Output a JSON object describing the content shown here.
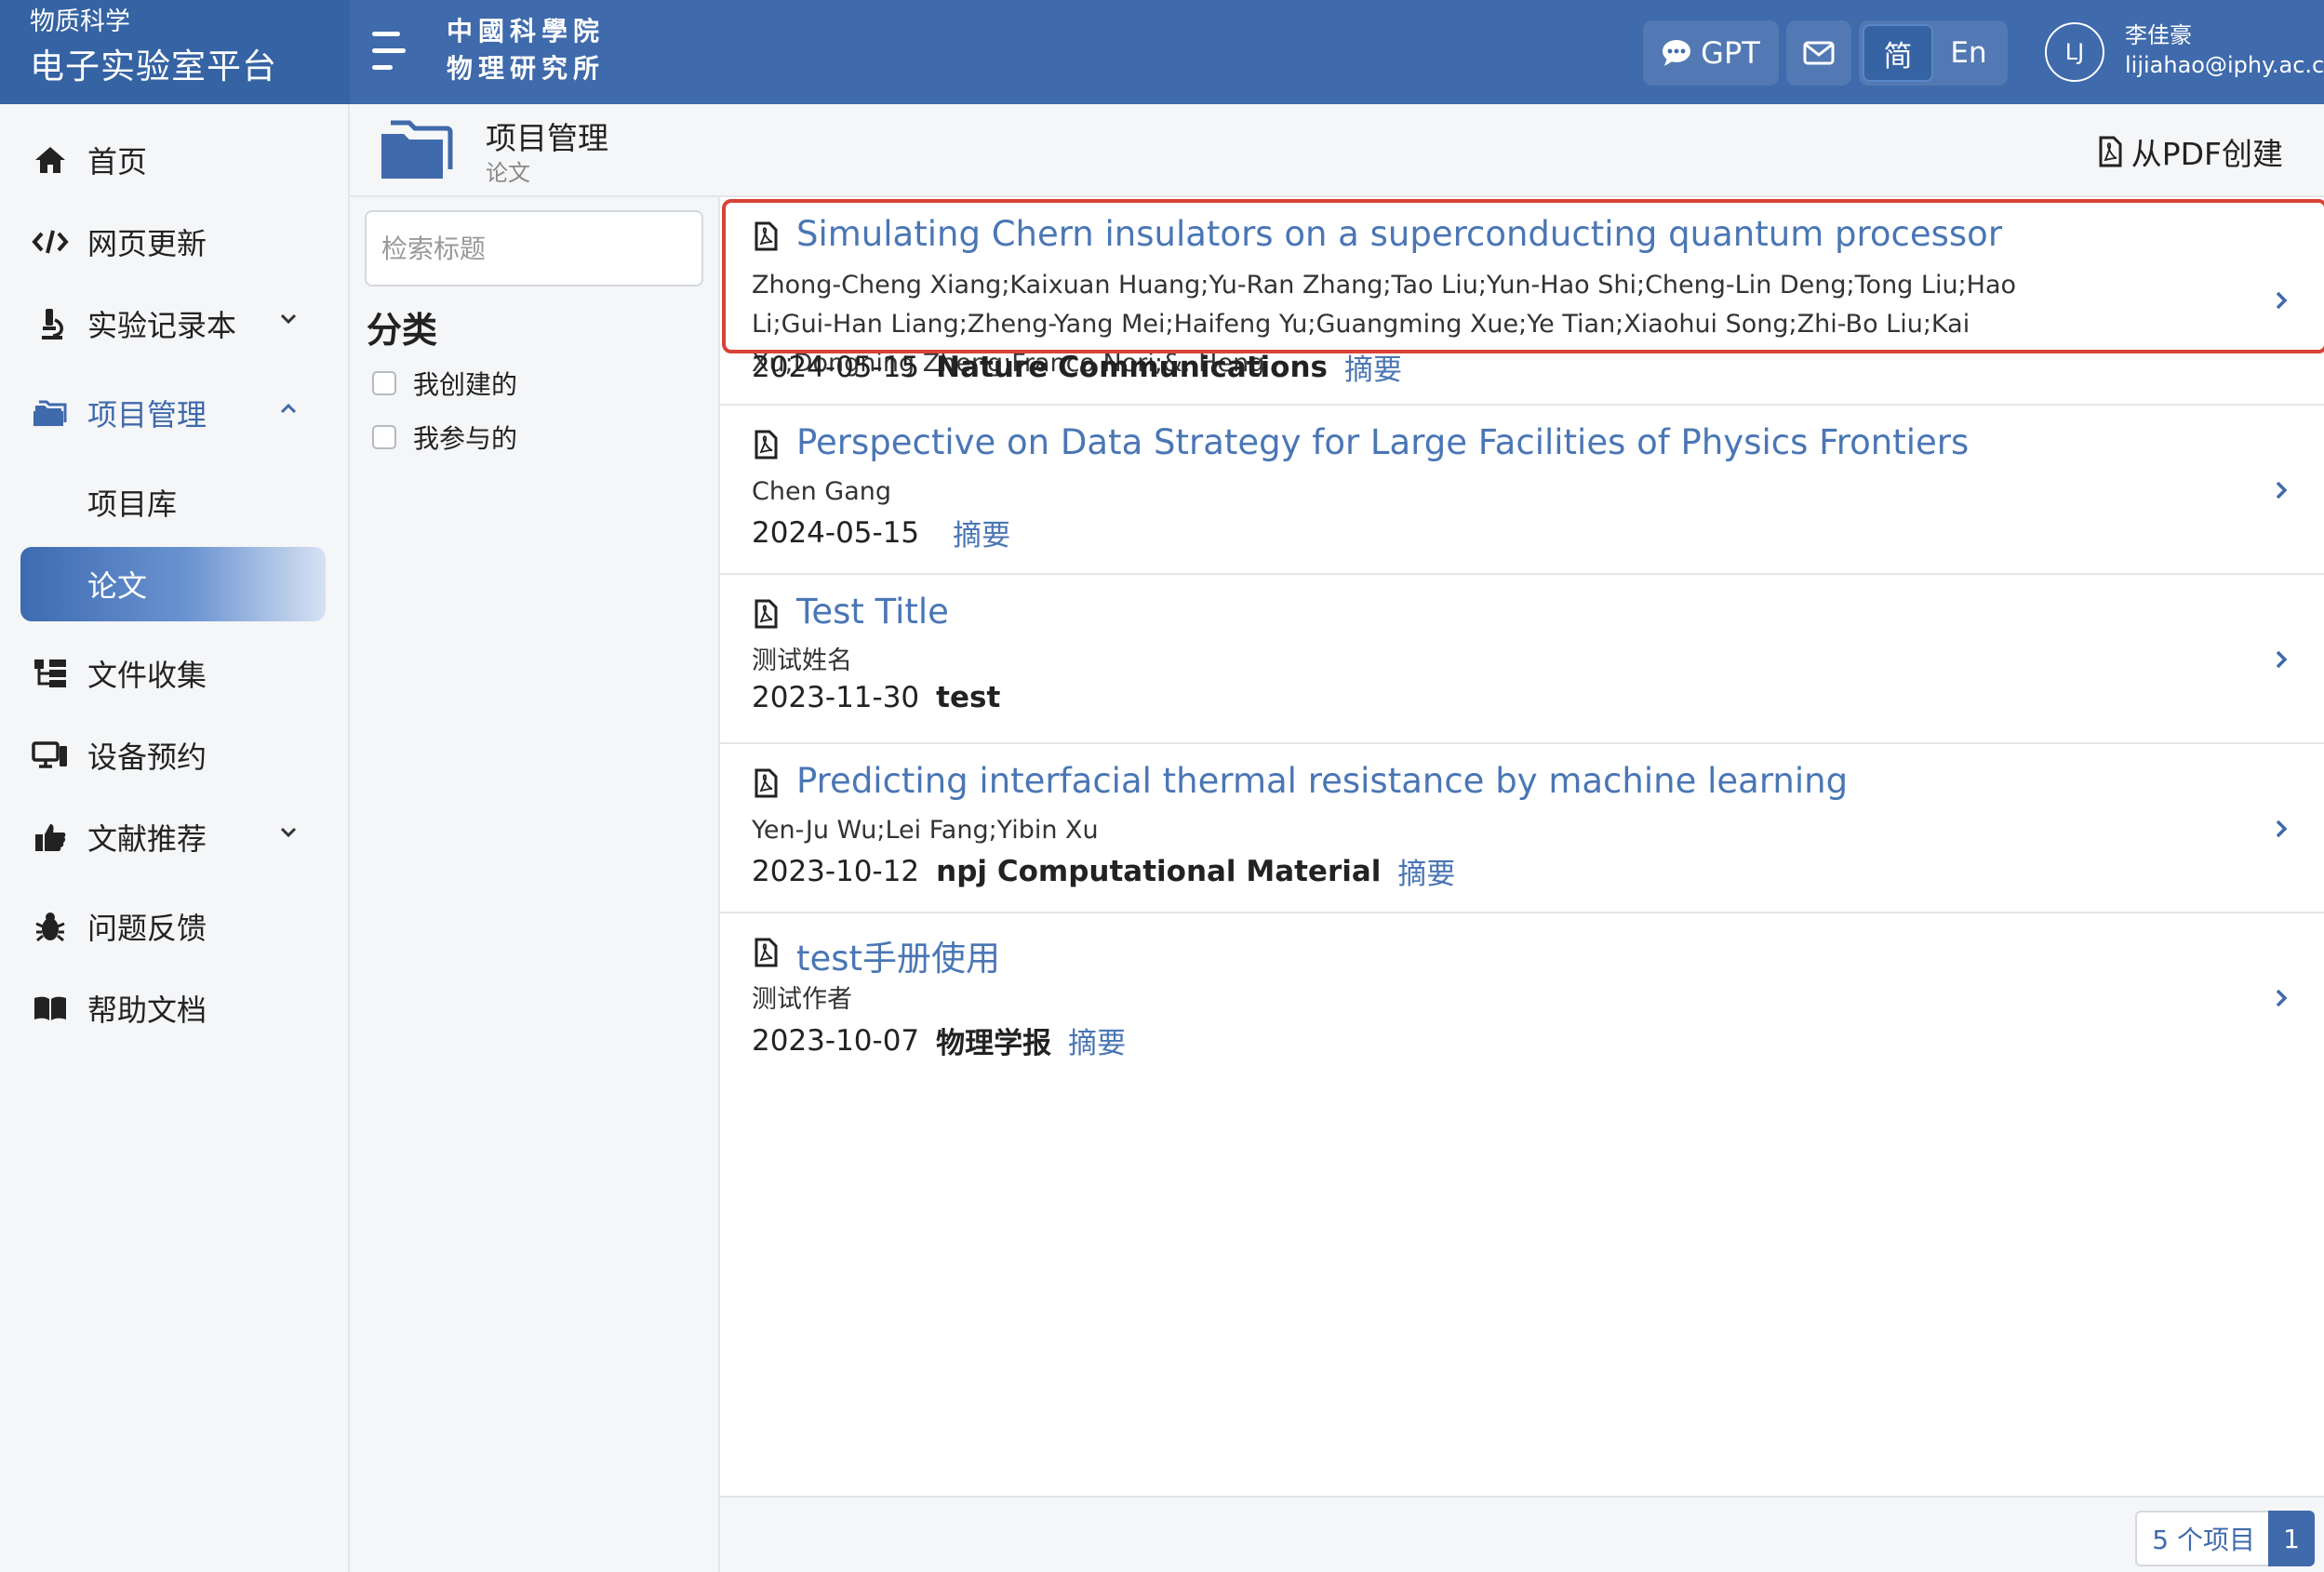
{
  "app": {
    "subtitle": "物质科学",
    "title": "电子实验室平台",
    "institute_line1": "中國科學院",
    "institute_line2": "物理研究所"
  },
  "topbar": {
    "gpt_label": "GPT",
    "lang_simplified": "简",
    "lang_english": "En",
    "avatar_initials": "LJ",
    "user_name": "李佳豪",
    "user_email": "lijiahao@iphy.ac.cn"
  },
  "sidebar": {
    "items": [
      {
        "label": "首页",
        "icon": "home-icon"
      },
      {
        "label": "网页更新",
        "icon": "code-icon"
      },
      {
        "label": "实验记录本",
        "icon": "microscope-icon"
      },
      {
        "label": "项目管理",
        "icon": "folder-icon"
      },
      {
        "label": "项目库"
      },
      {
        "label": "论文"
      },
      {
        "label": "文件收集",
        "icon": "sitemap-icon"
      },
      {
        "label": "设备预约",
        "icon": "devices-icon"
      },
      {
        "label": "文献推荐",
        "icon": "thumbs-up-icon"
      },
      {
        "label": "问题反馈",
        "icon": "bug-icon"
      },
      {
        "label": "帮助文档",
        "icon": "book-icon"
      }
    ]
  },
  "header": {
    "title": "项目管理",
    "subtitle": "论文",
    "create_from_pdf": "从PDF创建"
  },
  "filter": {
    "search_placeholder": "检索标题",
    "category_title": "分类",
    "options": [
      {
        "label": "我创建的",
        "checked": false
      },
      {
        "label": "我参与的",
        "checked": false
      }
    ]
  },
  "papers": [
    {
      "title": "Simulating Chern insulators on a superconducting quantum processor",
      "authors": "Zhong-Cheng Xiang;Kaixuan Huang;Yu-Ran Zhang;Tao Liu;Yun-Hao Shi;Cheng-Lin Deng;Tong Liu;Hao Li;Gui-Han Liang;Zheng-Yang Mei;Haifeng Yu;Guangming Xue;Ye Tian;Xiaohui Song;Zhi-Bo Liu;Kai Xu;Dongning Zheng;Franco Nori;&. Heng",
      "date": "2024-05-15",
      "journal": "Nature Communications",
      "abstract": "摘要"
    },
    {
      "title": "Perspective on Data Strategy for Large Facilities of Physics Frontiers",
      "authors": "Chen Gang",
      "date": "2024-05-15",
      "journal": "",
      "abstract": "摘要"
    },
    {
      "title": "Test Title",
      "authors": "测试姓名",
      "date": "2023-11-30",
      "journal": "test",
      "abstract": ""
    },
    {
      "title": "Predicting interfacial thermal resistance by machine learning",
      "authors": "Yen-Ju Wu;Lei Fang;Yibin Xu",
      "date": "2023-10-12",
      "journal": "npj Computational Material",
      "abstract": "摘要"
    },
    {
      "title": "test手册使用",
      "authors": "测试作者",
      "date": "2023-10-07",
      "journal": "物理学报",
      "abstract": "摘要"
    }
  ],
  "footer": {
    "count": "5 个项目",
    "page": "1"
  },
  "colors": {
    "topbar": "#3f6aab",
    "accent": "#4a76b4",
    "selection_border": "#d94235"
  }
}
